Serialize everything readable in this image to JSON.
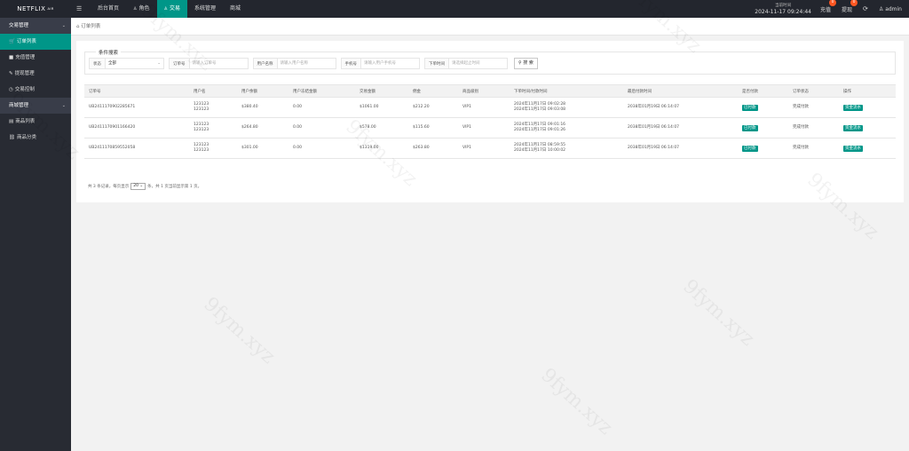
{
  "app": {
    "logo": "NETFLIX",
    "logo_sup": "AIR"
  },
  "top_nav": [
    {
      "label": "后台首页",
      "icon": "",
      "active": false
    },
    {
      "label": "角色",
      "icon": "user-icon",
      "active": false
    },
    {
      "label": "交易",
      "icon": "user-icon",
      "active": true
    },
    {
      "label": "系统管理",
      "icon": "",
      "active": false
    },
    {
      "label": "商城",
      "icon": "",
      "active": false
    }
  ],
  "top_right": {
    "time_label": "当前时间",
    "time_value": "2024-11-17 09:24:44",
    "recharge_label": "充值",
    "recharge_badge": "0",
    "withdraw_label": "提现",
    "withdraw_badge": "0",
    "refresh_icon": "refresh-icon",
    "user": "admin"
  },
  "sidebar": {
    "groups": [
      {
        "label": "交易管理",
        "items": [
          "订单列表",
          "充值管理",
          "提现管理",
          "交易控制"
        ]
      },
      {
        "label": "商城管理",
        "items": [
          "商品列表",
          "商品分类"
        ]
      }
    ]
  },
  "breadcrumb": "订单列表",
  "search": {
    "legend": "条件搜索",
    "status_label": "状态",
    "status_value": "全部",
    "order_label": "订单号",
    "order_placeholder": "请输入订单号",
    "username_label": "用户名称",
    "username_placeholder": "请输入用户名称",
    "phone_label": "手机号",
    "phone_placeholder": "请输入用户手机号",
    "time_label": "下单时间",
    "time_placeholder": "请选择起止时间",
    "button": "搜 索"
  },
  "table": {
    "headers": [
      "订单号",
      "用户名",
      "用户余额",
      "用户冻结金额",
      "交易金额",
      "佣金",
      "商品级别",
      "下单时间/付款时间",
      "最后付款时间",
      "是否付款",
      "订单状态",
      "操作"
    ],
    "rows": [
      {
        "order": "UB2411170902285671",
        "user1": "123123",
        "user2": "123123",
        "balance": "$380.40",
        "frozen": "0.00",
        "amount": "$1061.00",
        "commission": "$212.20",
        "level": "VIP1",
        "t1": "2024年11月17日 09:02:28",
        "t2": "2024年11月17日 09:03:08",
        "last": "2038年01月19日 06:14:07",
        "paid": "已付款",
        "state": "完成付款",
        "op": "资金流水"
      },
      {
        "order": "UB2411170901166420",
        "user1": "123123",
        "user2": "123123",
        "balance": "$264.80",
        "frozen": "0.00",
        "amount": "$578.00",
        "commission": "$115.60",
        "level": "VIP1",
        "t1": "2024年11月17日 09:01:16",
        "t2": "2024年11月17日 09:01:26",
        "last": "2038年01月19日 06:14:07",
        "paid": "已付款",
        "state": "完成付款",
        "op": "资金流水"
      },
      {
        "order": "UB2411170859552058",
        "user1": "123123",
        "user2": "123123",
        "balance": "$301.00",
        "frozen": "0.00",
        "amount": "$1319.00",
        "commission": "$263.80",
        "level": "VIP1",
        "t1": "2024年11月17日 08:59:55",
        "t2": "2024年11月17日 10:00:02",
        "last": "2038年01月19日 06:14:07",
        "paid": "已付款",
        "state": "完成付款",
        "op": "资金流水"
      }
    ]
  },
  "pager": {
    "prefix": "共 3 条记录，每页显示",
    "page_size": "20",
    "suffix": "条，共 1 页当前显示第 1 页。"
  },
  "watermark": "9fym.xyz",
  "colors": {
    "accent": "#009688",
    "topbar": "#23262e",
    "sidebar": "#282b33",
    "badge": "#ff5722"
  }
}
